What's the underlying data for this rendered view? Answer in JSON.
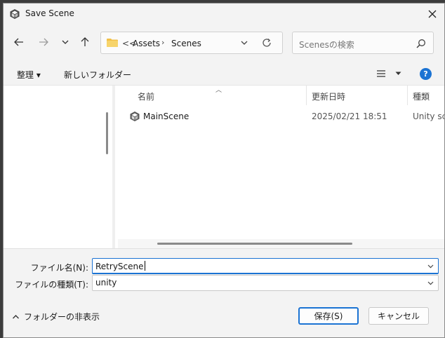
{
  "window": {
    "title": "Save Scene"
  },
  "nav": {
    "breadcrumb_overflow": "<<",
    "path": [
      "Assets",
      "Scenes"
    ],
    "search_placeholder": "Scenesの検索"
  },
  "toolbar": {
    "organize_label": "整理 ▾",
    "new_folder_label": "新しいフォルダー"
  },
  "file_list": {
    "columns": [
      "名前",
      "更新日時",
      "種類"
    ],
    "rows": [
      {
        "name": "MainScene",
        "modified": "2025/02/21 18:51",
        "type": "Unity sc"
      }
    ]
  },
  "form": {
    "filename_label": "ファイル名(N):",
    "filename_value": "RetryScene",
    "filetype_label": "ファイルの種類(T):",
    "filetype_value": "unity",
    "hide_folders_label": "フォルダーの非表示",
    "save_label": "保存(S)",
    "cancel_label": "キャンセル"
  },
  "colors": {
    "accent": "#1b73d3",
    "folder": "#f2c048"
  }
}
